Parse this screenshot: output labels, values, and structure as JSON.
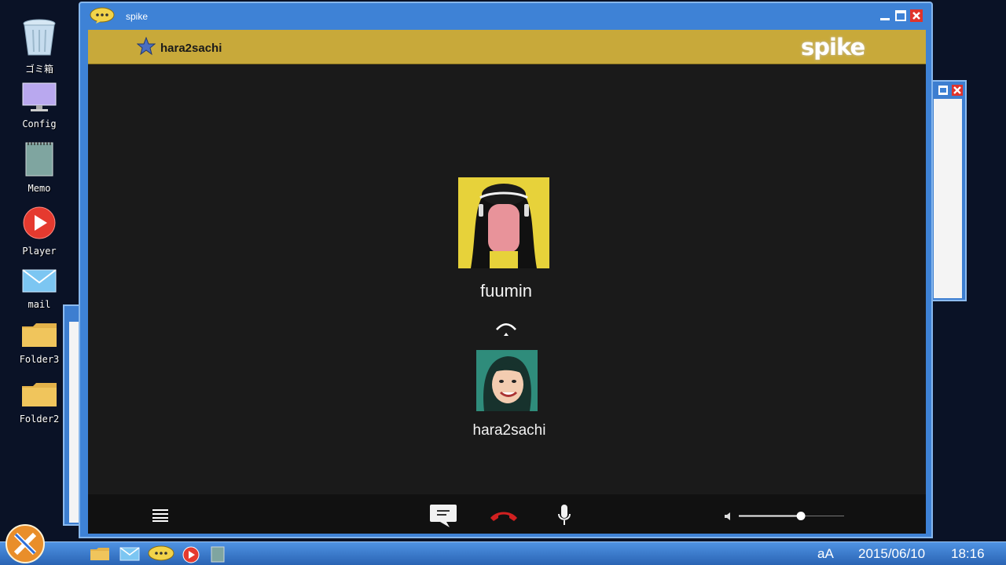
{
  "desktop": {
    "icons": [
      {
        "label": "ゴミ箱",
        "icon": "trash-icon"
      },
      {
        "label": "Config",
        "icon": "monitor-icon"
      },
      {
        "label": "Memo",
        "icon": "notepad-icon"
      },
      {
        "label": "Player",
        "icon": "play-icon"
      },
      {
        "label": "mail",
        "icon": "envelope-icon"
      },
      {
        "label": "Folder3",
        "icon": "folder-icon"
      },
      {
        "label": "Folder2",
        "icon": "folder-icon"
      }
    ]
  },
  "window": {
    "title": "spike",
    "contact": "hara2sachi",
    "brand": "spike"
  },
  "call": {
    "callee": "fuumin",
    "caller": "hara2sachi",
    "volume_level": 0.59
  },
  "taskbar": {
    "ime": "aA",
    "date": "2015/06/10",
    "time": "18:16"
  },
  "colors": {
    "header_gold": "#c8a93a",
    "window_blue": "#3e82d6",
    "hangup_red": "#d12020"
  }
}
